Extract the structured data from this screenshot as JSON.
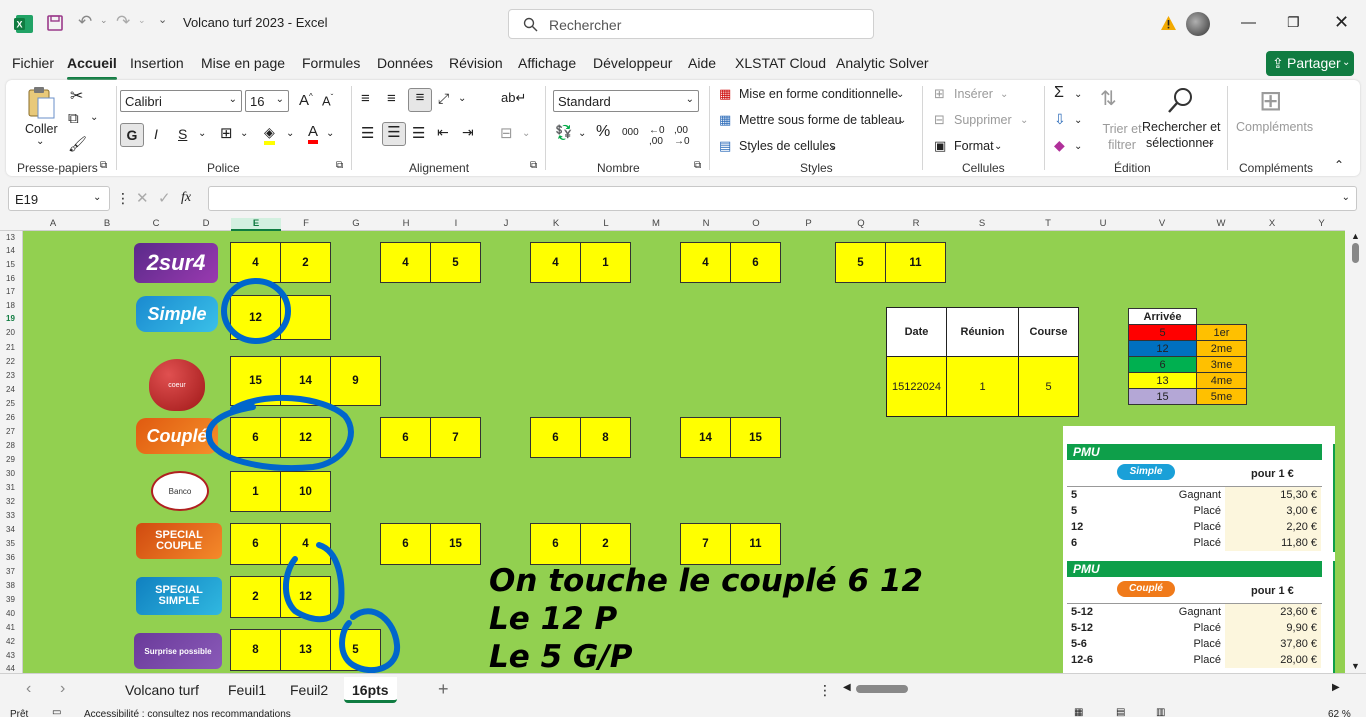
{
  "window": {
    "title": "Volcano turf 2023  -  Excel",
    "search_placeholder": "Rechercher"
  },
  "menu": [
    "Fichier",
    "Accueil",
    "Insertion",
    "Mise en page",
    "Formules",
    "Données",
    "Révision",
    "Affichage",
    "Développeur",
    "Aide",
    "XLSTAT Cloud",
    "Analytic Solver"
  ],
  "share_label": "Partager",
  "ribbon": {
    "groups": [
      "Presse-papiers",
      "Police",
      "Alignement",
      "Nombre",
      "Styles",
      "Cellules",
      "Édition",
      "Compléments"
    ],
    "paste_label": "Coller",
    "font_name": "Calibri",
    "font_size": "16",
    "number_format": "Standard",
    "styles": [
      "Mise en forme conditionnelle",
      "Mettre sous forme de tableau",
      "Styles de cellules"
    ],
    "cells": [
      "Insérer",
      "Supprimer",
      "Format"
    ],
    "edit_sort": "Trier et filtrer",
    "edit_find_1": "Rechercher et",
    "edit_find_2": "sélectionner",
    "addins": "Compléments",
    "bold": "G",
    "italic": "I",
    "underline": "S"
  },
  "formula_bar": {
    "name_box": "E19",
    "fx": "fx",
    "value": ""
  },
  "columns": [
    "A",
    "B",
    "C",
    "D",
    "E",
    "F",
    "G",
    "H",
    "I",
    "J",
    "K",
    "L",
    "M",
    "N",
    "O",
    "P",
    "Q",
    "R",
    "S",
    "T",
    "U",
    "V",
    "W",
    "X",
    "Y"
  ],
  "rows": [
    "13",
    "14",
    "15",
    "16",
    "17",
    "18",
    "19",
    "20",
    "21",
    "22",
    "23",
    "24",
    "25",
    "26",
    "27",
    "28",
    "29",
    "30",
    "31",
    "32",
    "33",
    "34",
    "35",
    "36",
    "37",
    "38",
    "39",
    "40",
    "41",
    "42",
    "43",
    "44"
  ],
  "bet_types": {
    "2sur4": "2sur4",
    "simple": "Simple",
    "coeur": "coeur",
    "couple": "Couplé",
    "banco": "Banco",
    "special_couple": "SPECIAL COUPLE",
    "special_simple": "SPECIAL SIMPLE",
    "surprise": "Surprise possible"
  },
  "grid": {
    "r2sur4": [
      [
        "4",
        "2"
      ],
      [
        "4",
        "5"
      ],
      [
        "4",
        "1"
      ],
      [
        "4",
        "6"
      ],
      [
        "5",
        "11"
      ]
    ],
    "simple": [
      "12",
      ""
    ],
    "coeur": [
      "15",
      "14",
      "9"
    ],
    "couple": [
      [
        "6",
        "12"
      ],
      [
        "6",
        "7"
      ],
      [
        "6",
        "8"
      ],
      [
        "14",
        "15"
      ]
    ],
    "banco": [
      "1",
      "10"
    ],
    "special_couple": [
      [
        "6",
        "4"
      ],
      [
        "6",
        "15"
      ],
      [
        "6",
        "2"
      ],
      [
        "7",
        "11"
      ]
    ],
    "special_simple": [
      "2",
      "12"
    ],
    "surprise": [
      "8",
      "13",
      "5"
    ]
  },
  "race_info": {
    "headers": [
      "Date",
      "Réunion",
      "Course"
    ],
    "values": [
      "15122024",
      "1",
      "5"
    ]
  },
  "arrivee": {
    "title": "Arrivée",
    "rows": [
      {
        "num": "5",
        "place": "1er",
        "color": "#ff0000"
      },
      {
        "num": "12",
        "place": "2me",
        "color": "#0070c0"
      },
      {
        "num": "6",
        "place": "3me",
        "color": "#00b050"
      },
      {
        "num": "13",
        "place": "4me",
        "color": "#ffff00"
      },
      {
        "num": "15",
        "place": "5me",
        "color": "#b4a7d6"
      }
    ]
  },
  "pmu": {
    "brand": "PMU",
    "simple": {
      "label": "Simple",
      "per": "pour 1 €",
      "rows": [
        {
          "a": "5",
          "b": "Gagnant",
          "c": "15,30 €"
        },
        {
          "a": "5",
          "b": "Placé",
          "c": "3,00 €"
        },
        {
          "a": "12",
          "b": "Placé",
          "c": "2,20 €"
        },
        {
          "a": "6",
          "b": "Placé",
          "c": "11,80 €"
        }
      ]
    },
    "couple": {
      "label": "Couplé",
      "per": "pour 1 €",
      "rows": [
        {
          "a": "5-12",
          "b": "Gagnant",
          "c": "23,60 €"
        },
        {
          "a": "5-12",
          "b": "Placé",
          "c": "9,90 €"
        },
        {
          "a": "5-6",
          "b": "Placé",
          "c": "37,80 €"
        },
        {
          "a": "12-6",
          "b": "Placé",
          "c": "28,00 €"
        }
      ]
    }
  },
  "annotation": {
    "line1": "On touche le couplé 6 12",
    "line2": "Le 12 P",
    "line3": "Le 5 G/P"
  },
  "sheet_tabs": [
    "Volcano turf",
    "Feuil1",
    "Feuil2",
    "16pts"
  ],
  "active_tab": "16pts",
  "status": {
    "ready": "Prêt",
    "accessibility": "Accessibilité : consultez nos recommandations",
    "zoom": "62 %"
  },
  "colors": {
    "excel_green": "#107c41",
    "sheet_green": "#92d050",
    "cell_yellow": "#ffff00",
    "circle_blue": "#0066cc"
  }
}
